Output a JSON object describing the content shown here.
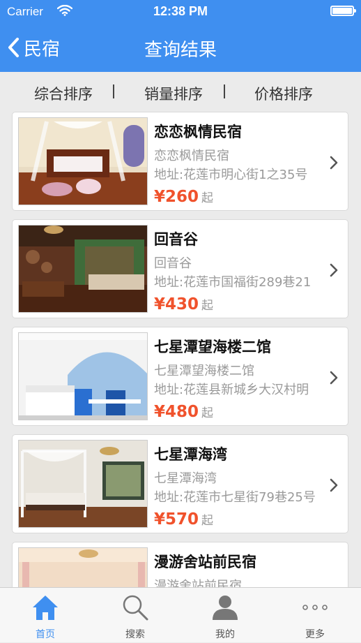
{
  "status_bar": {
    "carrier": "Carrier",
    "time": "12:38 PM"
  },
  "nav": {
    "back_label": "民宿",
    "title": "查询结果"
  },
  "sort": {
    "items": [
      "综合排序",
      "销量排序",
      "价格排序"
    ],
    "separator": "|"
  },
  "listings": [
    {
      "name": "恋恋枫情民宿",
      "subtitle": "恋恋枫情民宿",
      "address": "地址:花莲市明心街1之35号",
      "price": "¥260",
      "price_suffix": "起"
    },
    {
      "name": "回音谷",
      "subtitle": "回音谷",
      "address": "地址:花莲市国福街289巷21",
      "price": "¥430",
      "price_suffix": "起"
    },
    {
      "name": "七星潭望海楼二馆",
      "subtitle": "七星潭望海楼二馆",
      "address": "地址:花莲县新城乡大汉村明",
      "price": "¥480",
      "price_suffix": "起"
    },
    {
      "name": "七星潭海湾",
      "subtitle": "七星潭海湾",
      "address": "地址:花莲市七星街79巷25号",
      "price": "¥570",
      "price_suffix": "起"
    },
    {
      "name": "漫游舍站前民宿",
      "subtitle": "漫游舍站前民宿",
      "address": "",
      "price": "",
      "price_suffix": ""
    }
  ],
  "tabs": [
    {
      "label": "首页",
      "icon": "home-icon",
      "active": true
    },
    {
      "label": "搜索",
      "icon": "search-icon",
      "active": false
    },
    {
      "label": "我的",
      "icon": "person-icon",
      "active": false
    },
    {
      "label": "更多",
      "icon": "more-icon",
      "active": false
    }
  ],
  "colors": {
    "nav_bg": "#3f8ff0",
    "price": "#f0522c",
    "tab_active": "#3f8ff0"
  }
}
